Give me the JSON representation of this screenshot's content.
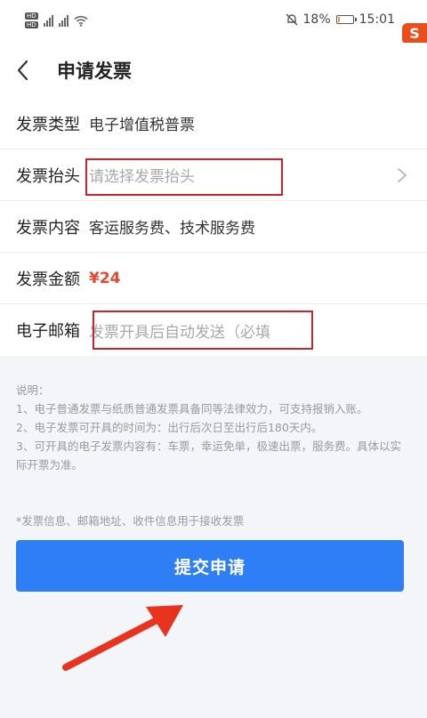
{
  "status_bar": {
    "hd_badge_1": "HD",
    "hd_badge_2": "HD",
    "battery_text": "18%",
    "time": "15:01",
    "battery_level": 0.18
  },
  "overlay_logo": {
    "text": "S"
  },
  "nav": {
    "title": "申请发票"
  },
  "form": {
    "rows": [
      {
        "label": "发票类型",
        "value": "电子增值税普票"
      },
      {
        "label": "发票抬头",
        "value": "请选择发票抬头"
      },
      {
        "label": "发票内容",
        "value": "客运服务费、技术服务费"
      },
      {
        "label": "发票金额",
        "value": "¥24"
      },
      {
        "label": "电子邮箱",
        "value": "发票开具后自动发送（必填"
      }
    ]
  },
  "notes": {
    "title": "说明：",
    "line1": "1、电子普通发票与纸质普通发票具备同等法律效力，可支持报销入账。",
    "line2": "2、电子发票可开具的时间为：出行后次日至出行后180天内。",
    "line3": "3、可开具的电子发票内容有：车票，幸运免单，极速出票，服务费。具体以实际开票为准。"
  },
  "tip": "*发票信息、邮箱地址、收件信息用于接收发票",
  "submit_label": "提交申请",
  "colors": {
    "accent": "#2e7ef6",
    "price": "#e8472c",
    "highlight": "#c9242c",
    "arrow": "#e8331f"
  },
  "icons": [
    "back-chevron-icon",
    "chevron-right-icon",
    "signal-icon",
    "wifi-icon",
    "mute-icon",
    "battery-icon",
    "arrow-annotation-icon"
  ]
}
